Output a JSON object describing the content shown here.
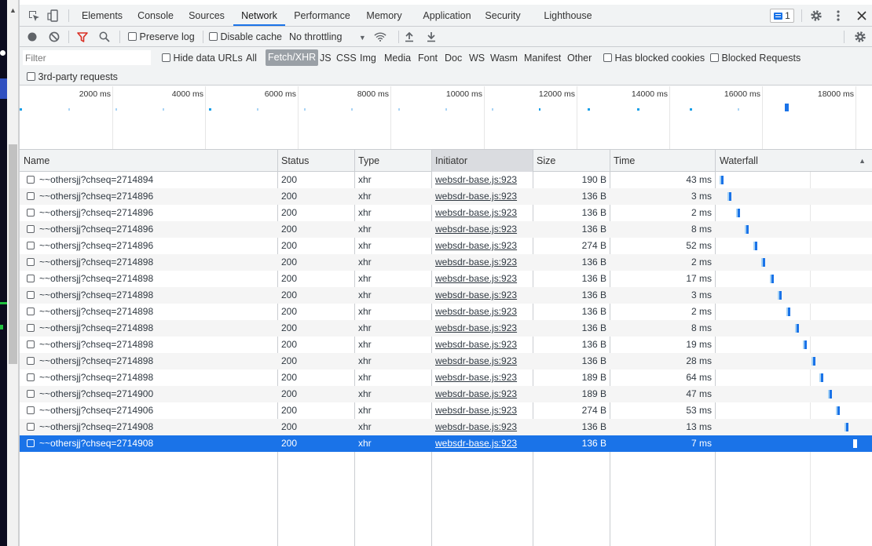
{
  "tabs": [
    {
      "label": "Elements"
    },
    {
      "label": "Console"
    },
    {
      "label": "Sources"
    },
    {
      "label": "Network",
      "active": true
    },
    {
      "label": "Performance"
    },
    {
      "label": "Memory"
    },
    {
      "label": "Application"
    },
    {
      "label": "Security"
    },
    {
      "label": "Lighthouse"
    }
  ],
  "issues_count": "1",
  "toolbar": {
    "preserve_log": "Preserve log",
    "disable_cache": "Disable cache",
    "throttling": "No throttling"
  },
  "filter": {
    "placeholder": "Filter",
    "hide_data_urls": "Hide data URLs",
    "types": [
      "All",
      "Fetch/XHR",
      "JS",
      "CSS",
      "Img",
      "Media",
      "Font",
      "Doc",
      "WS",
      "Wasm",
      "Manifest",
      "Other"
    ],
    "active_type": "Fetch/XHR",
    "has_blocked_cookies": "Has blocked cookies",
    "blocked_requests": "Blocked Requests",
    "third_party": "3rd-party requests"
  },
  "overview_labels": [
    "2000 ms",
    "4000 ms",
    "6000 ms",
    "8000 ms",
    "10000 ms",
    "12000 ms",
    "14000 ms",
    "16000 ms",
    "18000 ms"
  ],
  "columns": {
    "name": "Name",
    "status": "Status",
    "type": "Type",
    "initiator": "Initiator",
    "size": "Size",
    "time": "Time",
    "waterfall": "Waterfall"
  },
  "requests": [
    {
      "name": "~~othersjj?chseq=2714894",
      "status": "200",
      "type": "xhr",
      "initiator": "websdr-base.js:923",
      "size": "190 B",
      "time": "43 ms",
      "wf": 0.01
    },
    {
      "name": "~~othersjj?chseq=2714896",
      "status": "200",
      "type": "xhr",
      "initiator": "websdr-base.js:923",
      "size": "136 B",
      "time": "3 ms",
      "wf": 0.08
    },
    {
      "name": "~~othersjj?chseq=2714896",
      "status": "200",
      "type": "xhr",
      "initiator": "websdr-base.js:923",
      "size": "136 B",
      "time": "2 ms",
      "wf": 0.155
    },
    {
      "name": "~~othersjj?chseq=2714896",
      "status": "200",
      "type": "xhr",
      "initiator": "websdr-base.js:923",
      "size": "136 B",
      "time": "8 ms",
      "wf": 0.225
    },
    {
      "name": "~~othersjj?chseq=2714896",
      "status": "200",
      "type": "xhr",
      "initiator": "websdr-base.js:923",
      "size": "274 B",
      "time": "52 ms",
      "wf": 0.3
    },
    {
      "name": "~~othersjj?chseq=2714898",
      "status": "200",
      "type": "xhr",
      "initiator": "websdr-base.js:923",
      "size": "136 B",
      "time": "2 ms",
      "wf": 0.365
    },
    {
      "name": "~~othersjj?chseq=2714898",
      "status": "200",
      "type": "xhr",
      "initiator": "websdr-base.js:923",
      "size": "136 B",
      "time": "17 ms",
      "wf": 0.435
    },
    {
      "name": "~~othersjj?chseq=2714898",
      "status": "200",
      "type": "xhr",
      "initiator": "websdr-base.js:923",
      "size": "136 B",
      "time": "3 ms",
      "wf": 0.505
    },
    {
      "name": "~~othersjj?chseq=2714898",
      "status": "200",
      "type": "xhr",
      "initiator": "websdr-base.js:923",
      "size": "136 B",
      "time": "2 ms",
      "wf": 0.575
    },
    {
      "name": "~~othersjj?chseq=2714898",
      "status": "200",
      "type": "xhr",
      "initiator": "websdr-base.js:923",
      "size": "136 B",
      "time": "8 ms",
      "wf": 0.645
    },
    {
      "name": "~~othersjj?chseq=2714898",
      "status": "200",
      "type": "xhr",
      "initiator": "websdr-base.js:923",
      "size": "136 B",
      "time": "19 ms",
      "wf": 0.715
    },
    {
      "name": "~~othersjj?chseq=2714898",
      "status": "200",
      "type": "xhr",
      "initiator": "websdr-base.js:923",
      "size": "136 B",
      "time": "28 ms",
      "wf": 0.785
    },
    {
      "name": "~~othersjj?chseq=2714898",
      "status": "200",
      "type": "xhr",
      "initiator": "websdr-base.js:923",
      "size": "189 B",
      "time": "64 ms",
      "wf": 0.855
    },
    {
      "name": "~~othersjj?chseq=2714900",
      "status": "200",
      "type": "xhr",
      "initiator": "websdr-base.js:923",
      "size": "189 B",
      "time": "47 ms",
      "wf": 0.925
    },
    {
      "name": "~~othersjj?chseq=2714906",
      "status": "200",
      "type": "xhr",
      "initiator": "websdr-base.js:923",
      "size": "274 B",
      "time": "53 ms",
      "wf": 0.995
    },
    {
      "name": "~~othersjj?chseq=2714908",
      "status": "200",
      "type": "xhr",
      "initiator": "websdr-base.js:923",
      "size": "136 B",
      "time": "13 ms",
      "wf": 1.065
    },
    {
      "name": "~~othersjj?chseq=2714908",
      "status": "200",
      "type": "xhr",
      "initiator": "websdr-base.js:923",
      "size": "136 B",
      "time": "7 ms",
      "wf": 1.135,
      "selected": true
    }
  ],
  "colors": {
    "accent": "#1a73e8",
    "record_active": "#d93025",
    "filter_active": "#d93025"
  }
}
